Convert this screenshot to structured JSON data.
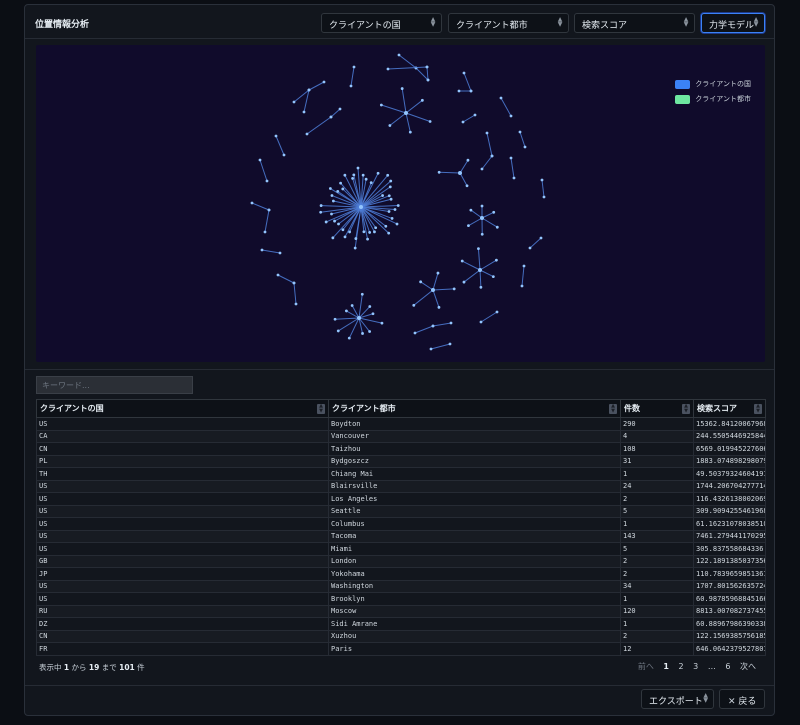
{
  "header": {
    "title": "位置情報分析",
    "selects": [
      {
        "label": "クライアントの国"
      },
      {
        "label": "クライアント都市"
      },
      {
        "label": "検索スコア"
      },
      {
        "label": "力学モデル"
      }
    ]
  },
  "graph": {
    "legend": [
      {
        "label": "クライアントの国",
        "color": "#3b82f6"
      },
      {
        "label": "クライアント都市",
        "color": "#6ee7a0"
      }
    ],
    "background": "#100b2b",
    "edge_color": "#4f7fd9",
    "node_color": "#93c5fd"
  },
  "search": {
    "placeholder": "キーワード..."
  },
  "table": {
    "columns": [
      "クライアントの国",
      "クライアント都市",
      "件数",
      "検索スコア"
    ],
    "rows": [
      [
        "US",
        "Boydton",
        "290",
        "15362.841200679683"
      ],
      [
        "CA",
        "Vancouver",
        "4",
        "244.55054469258448"
      ],
      [
        "CN",
        "Taizhou",
        "108",
        "6569.0199452276065"
      ],
      [
        "PL",
        "Bydgoszcz",
        "31",
        "1883.0748982980797"
      ],
      [
        "TH",
        "Chiang Mai",
        "1",
        "49.50379324604191"
      ],
      [
        "US",
        "Blairsville",
        "24",
        "1744.2067042777142"
      ],
      [
        "US",
        "Los Angeles",
        "2",
        "116.43261380020695"
      ],
      [
        "US",
        "Seattle",
        "5",
        "309.9094255461968"
      ],
      [
        "US",
        "Columbus",
        "1",
        "61.162310780385106"
      ],
      [
        "US",
        "Tacoma",
        "143",
        "7461.279441170295"
      ],
      [
        "US",
        "Miami",
        "5",
        "305.837558684336"
      ],
      [
        "GB",
        "London",
        "2",
        "122.18913850373565"
      ],
      [
        "JP",
        "Yokohama",
        "2",
        "110.78396598513615"
      ],
      [
        "US",
        "Washington",
        "34",
        "1707.8015626357242"
      ],
      [
        "US",
        "Brooklyn",
        "1",
        "60.987859688451664"
      ],
      [
        "RU",
        "Moscow",
        "120",
        "8813.007082737455"
      ],
      [
        "DZ",
        "Sidi Amrane",
        "1",
        "60.88967986390338"
      ],
      [
        "CN",
        "Xuzhou",
        "2",
        "122.1569385756185"
      ],
      [
        "FR",
        "Paris",
        "12",
        "646.0642379527801"
      ]
    ]
  },
  "pagination": {
    "info_prefix": "表示中",
    "from": "1",
    "from_label": "から",
    "to": "19",
    "to_label": "まで",
    "total": "101",
    "total_label": "件",
    "prev": "前へ",
    "pages": [
      "1",
      "2",
      "3"
    ],
    "ellipsis": "…",
    "last": "6",
    "next": "次へ"
  },
  "footer": {
    "export_label": "エクスポート",
    "back_label": "戻る"
  }
}
